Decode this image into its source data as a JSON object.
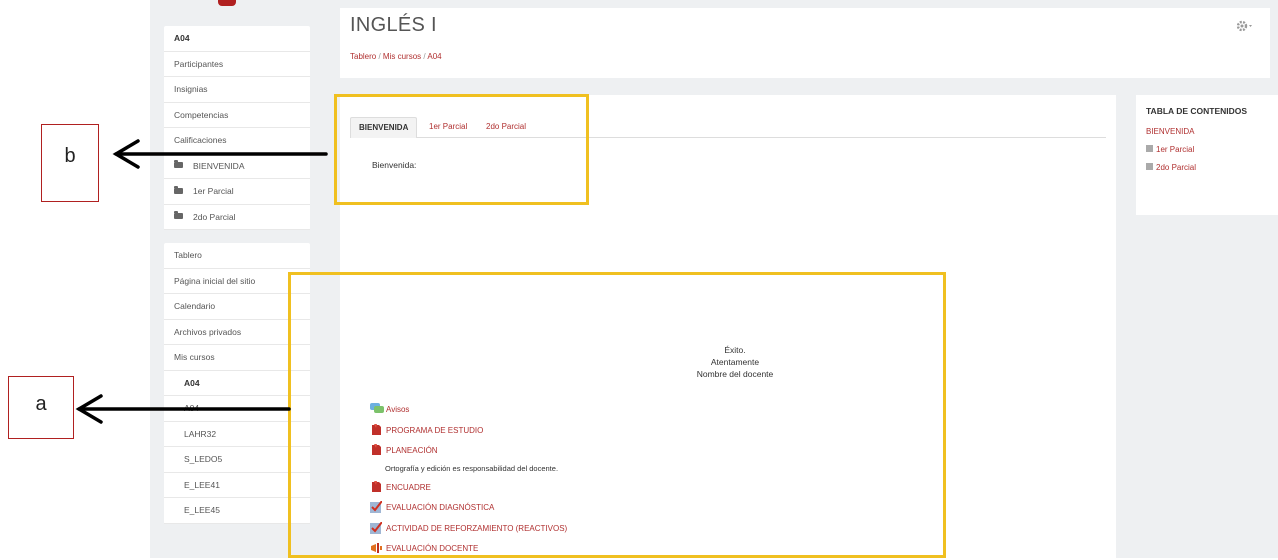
{
  "course": {
    "title": "INGLÉS I",
    "breadcrumb": [
      "Tablero",
      "Mis cursos",
      "A04"
    ],
    "breadcrumb_sep": " / "
  },
  "sidebar": {
    "course_block": [
      {
        "label": "A04",
        "bold": true
      },
      {
        "label": "Participantes"
      },
      {
        "label": "Insignias"
      },
      {
        "label": "Competencias"
      },
      {
        "label": "Calificaciones"
      },
      {
        "label": "BIENVENIDA",
        "folder": true
      },
      {
        "label": "1er Parcial",
        "folder": true
      },
      {
        "label": "2do Parcial",
        "folder": true
      }
    ],
    "nav_block": [
      {
        "label": "Tablero"
      },
      {
        "label": "Página inicial del sitio"
      },
      {
        "label": "Calendario"
      },
      {
        "label": "Archivos privados"
      },
      {
        "label": "Mis cursos"
      },
      {
        "label": "A04",
        "bold": true,
        "indent": true
      },
      {
        "label": "A04",
        "indent": true
      },
      {
        "label": "LAHR32",
        "indent": true
      },
      {
        "label": "S_LEDO5",
        "indent": true
      },
      {
        "label": "E_LEE41",
        "indent": true
      },
      {
        "label": "E_LEE45",
        "indent": true
      }
    ]
  },
  "tabs": [
    {
      "label": "BIENVENIDA",
      "active": true
    },
    {
      "label": "1er Parcial"
    },
    {
      "label": "2do Parcial"
    }
  ],
  "welcome_text": "Bienvenida:",
  "center_lines": [
    "Éxito.",
    "Atentamente",
    "Nombre del docente"
  ],
  "activities": [
    {
      "label": "Avisos",
      "icon": "forum-icon"
    },
    {
      "label": "PROGRAMA DE ESTUDIO",
      "icon": "pdf-icon"
    },
    {
      "label": "PLANEACIÓN",
      "icon": "pdf-icon"
    },
    {
      "label": "ENCUADRE",
      "icon": "pdf-icon"
    },
    {
      "label": "EVALUACIÓN DIAGNÓSTICA",
      "icon": "quiz-icon"
    },
    {
      "label": "ACTIVIDAD DE REFORZAMIENTO (REACTIVOS)",
      "icon": "quiz-icon"
    },
    {
      "label": "EVALUACIÓN DOCENTE",
      "icon": "feedback-icon"
    }
  ],
  "activity_note": "Ortografía y edición es responsabilidad del docente.",
  "toc": {
    "title": "TABLA DE CONTENIDOS",
    "items": [
      {
        "label": "BIENVENIDA",
        "box": false
      },
      {
        "label": "1er Parcial",
        "box": true
      },
      {
        "label": "2do Parcial",
        "box": true
      }
    ]
  },
  "annotations": {
    "a": "a",
    "b": "b",
    "highlight_color": "#f0c020"
  }
}
